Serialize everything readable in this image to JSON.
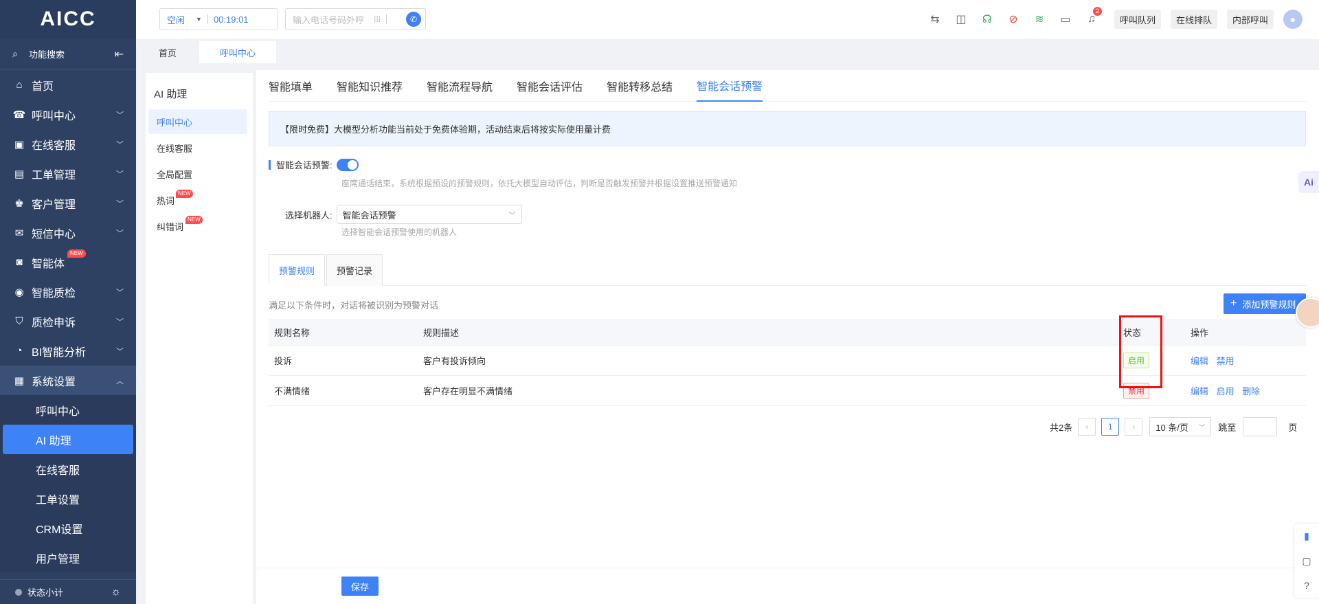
{
  "app": {
    "logo": "AICC"
  },
  "sidebar": {
    "search_label": "功能搜索",
    "items": [
      {
        "label": "首页",
        "icon": "home-icon"
      },
      {
        "label": "呼叫中心",
        "icon": "phone-icon"
      },
      {
        "label": "在线客服",
        "icon": "chat-icon"
      },
      {
        "label": "工单管理",
        "icon": "clipboard-icon"
      },
      {
        "label": "客户管理",
        "icon": "users-icon"
      },
      {
        "label": "短信中心",
        "icon": "mail-icon"
      },
      {
        "label": "智能体",
        "icon": "robot-icon",
        "badge": "NEW"
      },
      {
        "label": "智能质检",
        "icon": "chart-icon"
      },
      {
        "label": "质检申诉",
        "icon": "shield-icon"
      },
      {
        "label": "BI智能分析",
        "icon": "pie-icon"
      },
      {
        "label": "系统设置",
        "icon": "grid-icon"
      }
    ],
    "sub_items": [
      "呼叫中心",
      "AI 助理",
      "在线客服",
      "工单设置",
      "CRM设置",
      "用户管理"
    ],
    "footer_label": "状态小计"
  },
  "header": {
    "status": "空闲",
    "timer": "00:19:01",
    "dial_placeholder": "输入电话号码外呼",
    "notification_count": "2",
    "buttons": [
      "呼叫队列",
      "在线排队",
      "内部呼叫"
    ]
  },
  "top_tabs": [
    "首页",
    "呼叫中心"
  ],
  "submenu": {
    "title": "AI 助理",
    "items": [
      {
        "label": "呼叫中心"
      },
      {
        "label": "在线客服"
      },
      {
        "label": "全局配置"
      },
      {
        "label": "热词",
        "badge": "NEW"
      },
      {
        "label": "纠错词",
        "badge": "NEW"
      }
    ]
  },
  "feature_tabs": [
    "智能填单",
    "智能知识推荐",
    "智能流程导航",
    "智能会话评估",
    "智能转移总结",
    "智能会话预警"
  ],
  "notice": "【限时免费】大模型分析功能当前处于免费体验期，活动结束后将按实际使用量计费",
  "form": {
    "warning_label": "智能会话预警:",
    "warning_help": "座席通话结束，系统根据预设的预警规则，依托大模型自动评估，判断是否触发预警并根据设置推送预警通知",
    "robot_label": "选择机器人:",
    "robot_value": "智能会话预警",
    "robot_help": "选择智能会话预警使用的机器人"
  },
  "rule_tabs": [
    "预警规则",
    "预警记录"
  ],
  "condition_text": "满足以下条件时，对话将被识别为预警对话",
  "add_rule_button": "添加预警规则",
  "table": {
    "headers": [
      "规则名称",
      "规则描述",
      "状态",
      "操作"
    ],
    "rows": [
      {
        "name": "投诉",
        "desc": "客户有投诉倾向",
        "status": "启用",
        "ops": [
          "编辑",
          "禁用"
        ]
      },
      {
        "name": "不满情绪",
        "desc": "客户存在明显不满情绪",
        "status": "禁用",
        "ops": [
          "编辑",
          "启用",
          "删除"
        ]
      }
    ]
  },
  "pager": {
    "total": "共2条",
    "current": "1",
    "page_size": "10 条/页",
    "jump_label": "跳至",
    "page_unit": "页"
  },
  "save_button": "保存",
  "colors": {
    "primary": "#3e82f7",
    "sidebar": "#2e4163",
    "highlight": "#ee1111"
  }
}
